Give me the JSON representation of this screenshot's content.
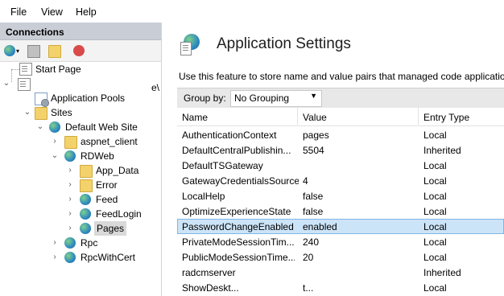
{
  "menu": {
    "file": "File",
    "view": "View",
    "help": "Help"
  },
  "connections": {
    "title": "Connections",
    "truncated_label": "e\\",
    "tree": [
      {
        "label": "Start Page",
        "icon": "start-page-icon"
      },
      {
        "label": "Application Pools",
        "icon": "app-pools-icon"
      },
      {
        "label": "Sites",
        "icon": "sites-folder-icon"
      },
      {
        "label": "Default Web Site",
        "icon": "globe-icon"
      },
      {
        "label": "aspnet_client",
        "icon": "folder-icon"
      },
      {
        "label": "RDWeb",
        "icon": "web-app-icon"
      },
      {
        "label": "App_Data",
        "icon": "folder-icon"
      },
      {
        "label": "Error",
        "icon": "folder-icon"
      },
      {
        "label": "Feed",
        "icon": "web-app-icon"
      },
      {
        "label": "FeedLogin",
        "icon": "web-app-icon"
      },
      {
        "label": "Pages",
        "icon": "web-app-icon"
      },
      {
        "label": "Rpc",
        "icon": "web-app-icon"
      },
      {
        "label": "RpcWithCert",
        "icon": "web-app-icon"
      }
    ]
  },
  "main": {
    "title": "Application Settings",
    "description": "Use this feature to store name and value pairs that managed code applicatio",
    "group_by_label": "Group by:",
    "group_by_value": "No Grouping",
    "columns": [
      "Name",
      "Value",
      "Entry Type"
    ],
    "rows": [
      {
        "name": "AuthenticationContext",
        "value": "pages",
        "type": "Local"
      },
      {
        "name": "DefaultCentralPublishin...",
        "value": "5504",
        "type": "Inherited"
      },
      {
        "name": "DefaultTSGateway",
        "value": "",
        "type": "Local"
      },
      {
        "name": "GatewayCredentialsSource",
        "value": "4",
        "type": "Local"
      },
      {
        "name": "LocalHelp",
        "value": "false",
        "type": "Local"
      },
      {
        "name": "OptimizeExperienceState",
        "value": "false",
        "type": "Local"
      },
      {
        "name": "PasswordChangeEnabled",
        "value": "enabled",
        "type": "Local"
      },
      {
        "name": "PrivateModeSessionTim...",
        "value": "240",
        "type": "Local"
      },
      {
        "name": "PublicModeSessionTime...",
        "value": "20",
        "type": "Local"
      },
      {
        "name": "radcmserver",
        "value": "",
        "type": "Inherited"
      },
      {
        "name": "ShowDeskt...",
        "value": "t...",
        "type": "Local"
      }
    ]
  },
  "colors": {
    "selection": "#cce4f7",
    "header": "#c9ced6"
  }
}
